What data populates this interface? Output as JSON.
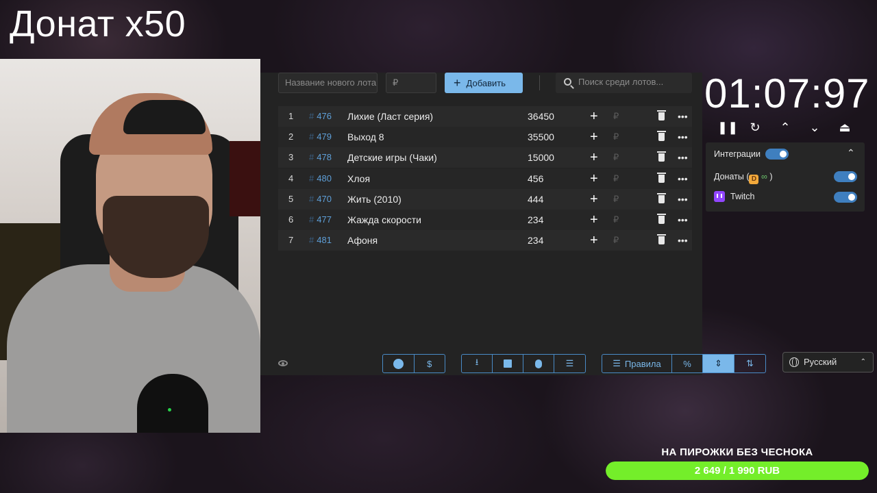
{
  "overlay": {
    "title": "Донат x50"
  },
  "toolbar": {
    "lot_name_placeholder": "Название нового лота",
    "price_placeholder": "₽",
    "add_label": "Добавить",
    "search_placeholder": "Поиск среди лотов..."
  },
  "lots": [
    {
      "index": "1",
      "id": "476",
      "name": "Лихие (Ласт серия)",
      "amount": "36450"
    },
    {
      "index": "2",
      "id": "479",
      "name": "Выход 8",
      "amount": "35500"
    },
    {
      "index": "3",
      "id": "478",
      "name": "Детские игры (Чаки)",
      "amount": "15000"
    },
    {
      "index": "4",
      "id": "480",
      "name": "Хлоя",
      "amount": "456"
    },
    {
      "index": "5",
      "id": "470",
      "name": "Жить (2010)",
      "amount": "444"
    },
    {
      "index": "6",
      "id": "477",
      "name": "Жажда скорости",
      "amount": "234"
    },
    {
      "index": "7",
      "id": "481",
      "name": "Афоня",
      "amount": "234"
    }
  ],
  "row_symbols": {
    "hash": "#",
    "plus": "+",
    "rub": "₽",
    "more": "•••"
  },
  "bottom": {
    "rules_label": "Правила",
    "percent_label": "%",
    "dollar_label": "$"
  },
  "timer": {
    "value": "01:07:97"
  },
  "integrations": {
    "header_label": "Интеграции",
    "donations_label": "Донаты (",
    "donations_suffix": ")",
    "donation_badge": "D",
    "donation_icon_glyph": "∞",
    "twitch_label": "Twitch",
    "enabled": true,
    "donations_enabled": true,
    "twitch_enabled": true
  },
  "language": {
    "selected": "Русский"
  },
  "goal": {
    "title": "НА ПИРОЖКИ БЕЗ ЧЕСНОКА",
    "progress_text": "2 649 / 1 990 RUB",
    "progress_fraction": 1.0
  },
  "colors": {
    "accent": "#7ab8ea",
    "goal_fill": "#74ee2a",
    "twitch": "#9146ff"
  }
}
